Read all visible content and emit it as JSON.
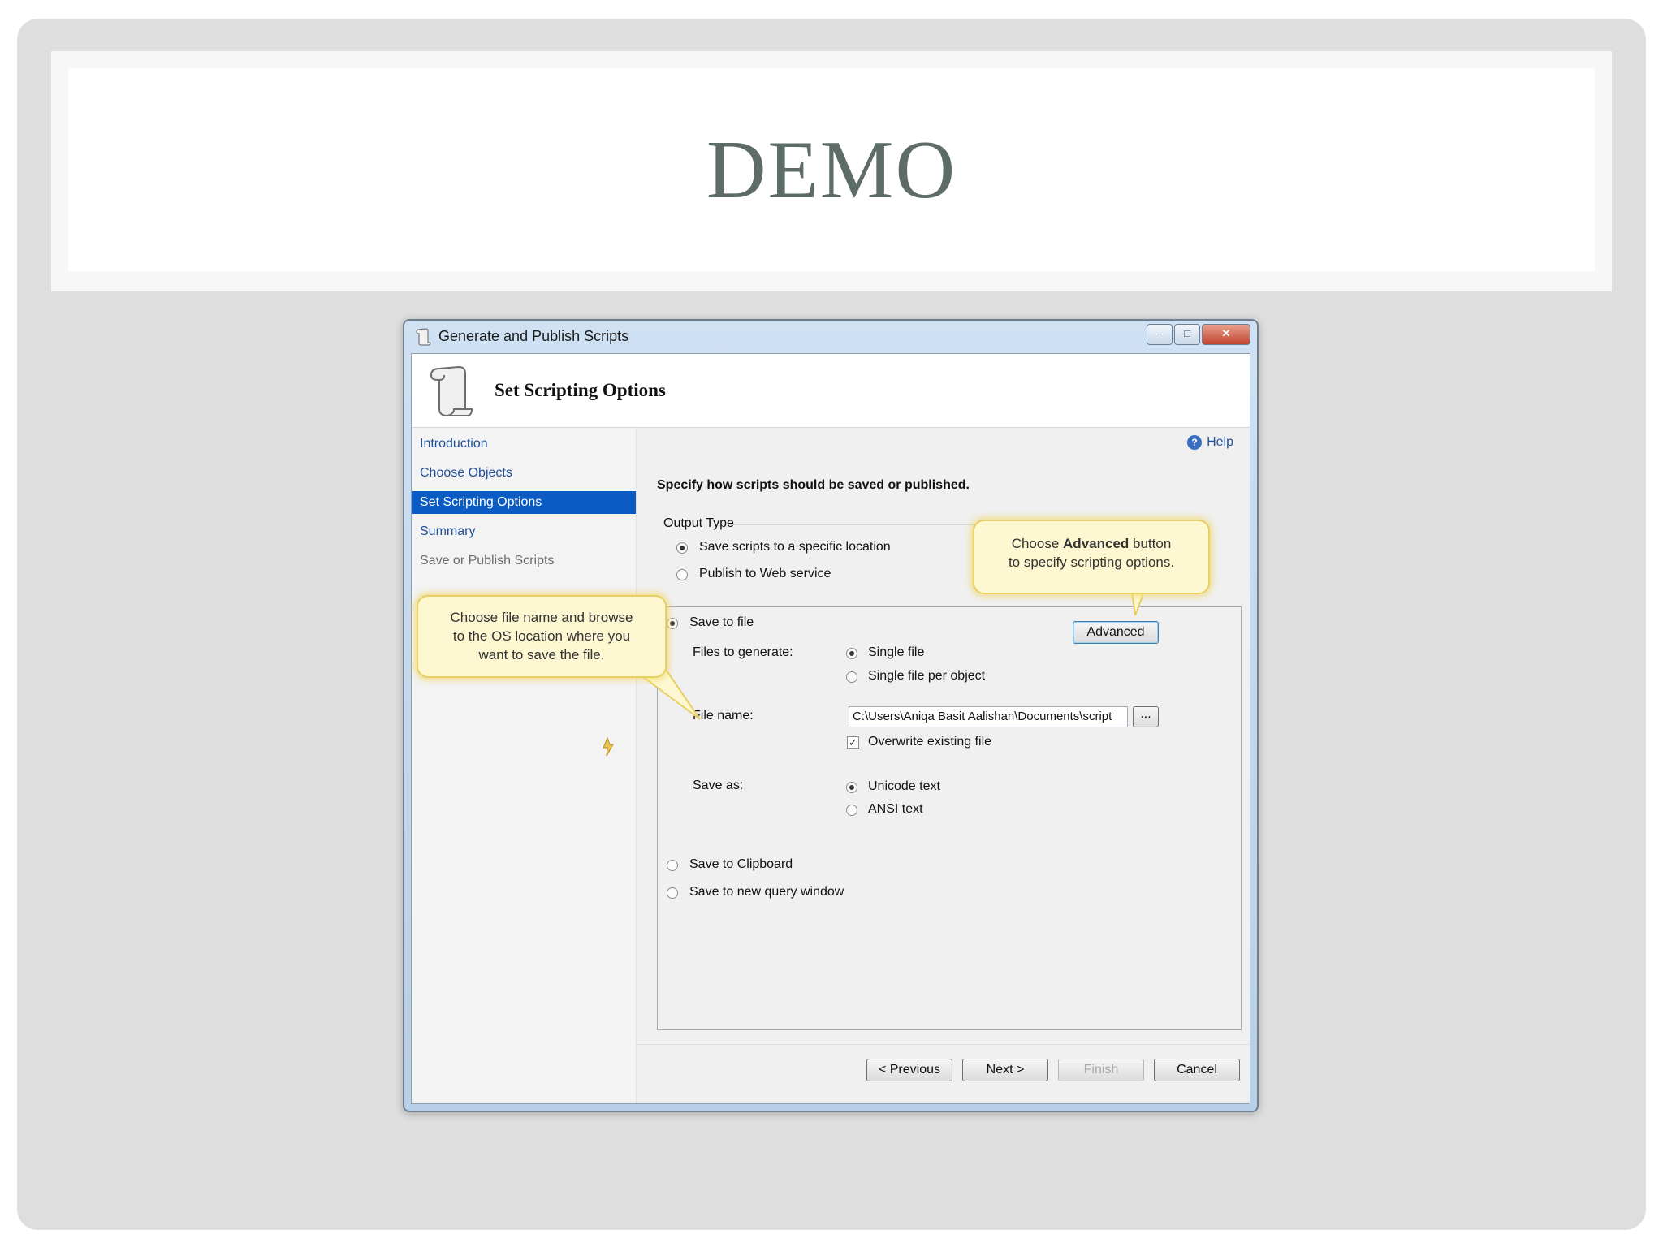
{
  "slide": {
    "title": "DEMO"
  },
  "dialog": {
    "window_title": "Generate and Publish Scripts",
    "header_title": "Set Scripting Options",
    "nav": [
      {
        "label": "Introduction"
      },
      {
        "label": "Choose Objects"
      },
      {
        "label": "Set Scripting Options",
        "selected": true
      },
      {
        "label": "Summary"
      },
      {
        "label": "Save or Publish Scripts"
      }
    ],
    "help_label": "Help",
    "instruction": "Specify how scripts should be saved or published.",
    "output_type": {
      "label": "Output Type",
      "option_save": "Save scripts to a specific location",
      "option_publish": "Publish to Web service"
    },
    "save_to_file": "Save to file",
    "files_to_generate": {
      "label": "Files to generate:",
      "option_single": "Single file",
      "option_per_object": "Single file per object"
    },
    "file_name": {
      "label": "File name:",
      "value": "C:\\Users\\Aniqa Basit Aalishan\\Documents\\script",
      "browse": "..."
    },
    "overwrite": "Overwrite existing file",
    "save_as": {
      "label": "Save as:",
      "option_unicode": "Unicode text",
      "option_ansi": "ANSI text"
    },
    "save_to_clipboard": "Save to Clipboard",
    "save_to_query": "Save to new query window",
    "advanced_button": "Advanced",
    "buttons": {
      "previous": "< Previous",
      "next": "Next >",
      "finish": "Finish",
      "cancel": "Cancel"
    }
  },
  "callouts": {
    "advanced_pre": "Choose ",
    "advanced_bold": "Advanced",
    "advanced_post": " button",
    "advanced_line2": "to specify scripting options.",
    "file_line1": "Choose file name and browse",
    "file_line2": "to the OS location where you",
    "file_line3": "want to save the file."
  }
}
